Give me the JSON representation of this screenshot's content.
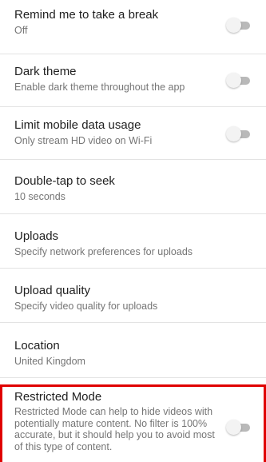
{
  "settings": {
    "remind_break": {
      "title": "Remind me to take a break",
      "subtitle": "Off",
      "enabled": false
    },
    "dark_theme": {
      "title": "Dark theme",
      "subtitle": "Enable dark theme throughout the app",
      "enabled": false
    },
    "limit_data": {
      "title": "Limit mobile data usage",
      "subtitle": "Only stream HD video on Wi-Fi",
      "enabled": false
    },
    "double_tap": {
      "title": "Double-tap to seek",
      "subtitle": "10 seconds"
    },
    "uploads": {
      "title": "Uploads",
      "subtitle": "Specify network preferences for uploads"
    },
    "upload_quality": {
      "title": "Upload quality",
      "subtitle": "Specify video quality for uploads"
    },
    "location": {
      "title": "Location",
      "subtitle": "United Kingdom"
    },
    "restricted_mode": {
      "title": "Restricted Mode",
      "subtitle": "Restricted Mode can help to hide videos with potentially mature content. No filter is 100% accurate, but it should help you to avoid most of this type of content.",
      "enabled": false,
      "highlight_color": "#e00000"
    }
  }
}
